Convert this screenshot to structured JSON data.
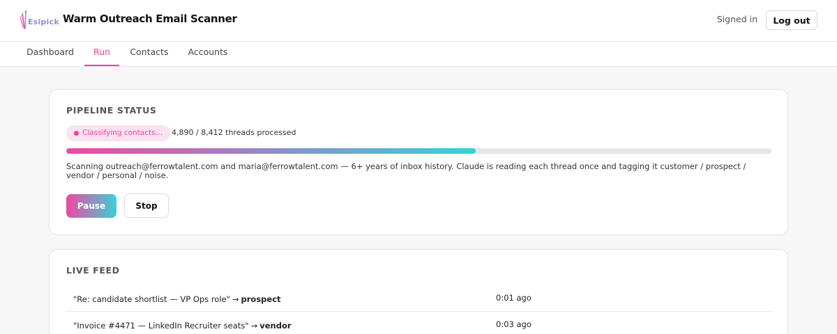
{
  "header": {
    "logo_text": "Esipick",
    "app_title": "Warm Outreach Email Scanner",
    "signed_in_label": "Signed in",
    "logout_label": "Log out"
  },
  "nav": {
    "tabs": [
      {
        "label": "Dashboard",
        "active": false
      },
      {
        "label": "Run",
        "active": true
      },
      {
        "label": "Contacts",
        "active": false
      },
      {
        "label": "Accounts",
        "active": false
      }
    ]
  },
  "pipeline": {
    "title": "PIPELINE STATUS",
    "status_badge": "Classifying contacts…",
    "progress_text": "4,890 / 8,412 threads processed",
    "progress_fraction": 0.581,
    "description": "Scanning outreach@ferrowtalent.com and maria@ferrowtalent.com — 6+ years of inbox history. Claude is reading each thread once and tagging it customer / prospect / vendor / personal / noise.",
    "pause_label": "Pause",
    "stop_label": "Stop"
  },
  "feed": {
    "title": "LIVE FEED",
    "arrow": "→",
    "items": [
      {
        "subject": "\"Re: candidate shortlist — VP Ops role\"",
        "tag": "prospect",
        "time": "0:01 ago"
      },
      {
        "subject": "\"Invoice #4471 — LinkedIn Recruiter seats\"",
        "tag": "vendor",
        "time": "0:03 ago"
      }
    ]
  },
  "colors": {
    "accent": "#e8459a",
    "accent_soft": "#fbe2ef",
    "gradient_start": "#ee4aa0",
    "gradient_end": "#34d3d6"
  }
}
